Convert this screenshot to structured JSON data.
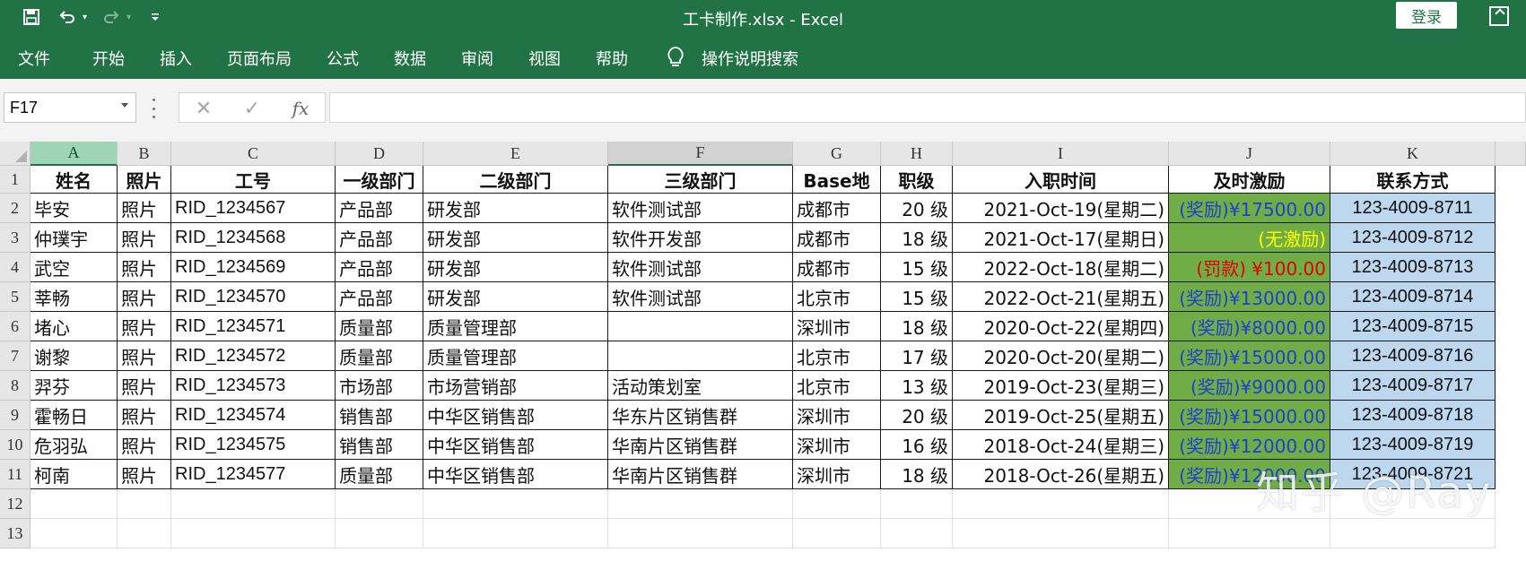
{
  "window": {
    "title": "工卡制作.xlsx  -  Excel",
    "login_label": "登录"
  },
  "icons": {
    "save": "save-icon",
    "undo": "undo-icon",
    "redo": "redo-icon",
    "customize": "customize-qat-icon",
    "tell_me": "lightbulb-icon"
  },
  "ribbon": {
    "tabs": [
      "文件",
      "开始",
      "插入",
      "页面布局",
      "公式",
      "数据",
      "审阅",
      "视图",
      "帮助"
    ],
    "tell_me": "操作说明搜索"
  },
  "formula_bar": {
    "name_box": "F17",
    "cancel_glyph": "✕",
    "enter_glyph": "✓",
    "fx_label": "fx",
    "formula": ""
  },
  "sheet": {
    "columns": [
      "A",
      "B",
      "C",
      "D",
      "E",
      "F",
      "G",
      "H",
      "I",
      "J",
      "K"
    ],
    "rows": [
      "1",
      "2",
      "3",
      "4",
      "5",
      "6",
      "7",
      "8",
      "9",
      "10",
      "11",
      "12",
      "13"
    ],
    "header": [
      "姓名",
      "照片",
      "工号",
      "一级部门",
      "二级部门",
      "三级部门",
      "Base地",
      "职级",
      "入职时间",
      "及时激励",
      "联系方式"
    ],
    "data": [
      [
        "毕安",
        "照片",
        "RID_1234567",
        "产品部",
        "研发部",
        "软件测试部",
        "成都市",
        "20 级",
        "2021-Oct-19(星期二)",
        "(奖励)¥17500.00",
        "123-4009-8711"
      ],
      [
        "仲璞宇",
        "照片",
        "RID_1234568",
        "产品部",
        "研发部",
        "软件开发部",
        "成都市",
        "18 级",
        "2021-Oct-17(星期日)",
        "(无激励)",
        "123-4009-8712"
      ],
      [
        "武空",
        "照片",
        "RID_1234569",
        "产品部",
        "研发部",
        "软件测试部",
        "成都市",
        "15 级",
        "2022-Oct-18(星期二)",
        "(罚款) ¥100.00",
        "123-4009-8713"
      ],
      [
        "莘畅",
        "照片",
        "RID_1234570",
        "产品部",
        "研发部",
        "软件测试部",
        "北京市",
        "15 级",
        "2022-Oct-21(星期五)",
        "(奖励)¥13000.00",
        "123-4009-8714"
      ],
      [
        "堵心",
        "照片",
        "RID_1234571",
        "质量部",
        "质量管理部",
        "",
        "深圳市",
        "18 级",
        "2020-Oct-22(星期四)",
        "(奖励)¥8000.00",
        "123-4009-8715"
      ],
      [
        "谢黎",
        "照片",
        "RID_1234572",
        "质量部",
        "质量管理部",
        "",
        "北京市",
        "17 级",
        "2020-Oct-20(星期二)",
        "(奖励)¥15000.00",
        "123-4009-8716"
      ],
      [
        "羿芬",
        "照片",
        "RID_1234573",
        "市场部",
        "市场营销部",
        "活动策划室",
        "北京市",
        "13 级",
        "2019-Oct-23(星期三)",
        "(奖励)¥9000.00",
        "123-4009-8717"
      ],
      [
        "霍畅日",
        "照片",
        "RID_1234574",
        "销售部",
        "中华区销售部",
        "华东片区销售群",
        "深圳市",
        "20 级",
        "2019-Oct-25(星期五)",
        "(奖励)¥15000.00",
        "123-4009-8718"
      ],
      [
        "危羽弘",
        "照片",
        "RID_1234575",
        "销售部",
        "中华区销售部",
        "华南片区销售群",
        "深圳市",
        "16 级",
        "2018-Oct-24(星期三)",
        "(奖励)¥12000.00",
        "123-4009-8719"
      ],
      [
        "柯南",
        "照片",
        "RID_1234577",
        "质量部",
        "中华区销售部",
        "华南片区销售群",
        "深圳市",
        "18 级",
        "2018-Oct-26(星期五)",
        "(奖励)¥12000.00",
        "123-4009-8721"
      ]
    ],
    "incentive_colors": {
      "reward": "#1f3fcf",
      "none": "#ffff00",
      "fine": "#e00000",
      "fill": "#70ad47",
      "contact_fill": "#bdd7ee"
    }
  },
  "watermark": "知乎 @Ray",
  "theme": {
    "excel_green": "#217346"
  }
}
